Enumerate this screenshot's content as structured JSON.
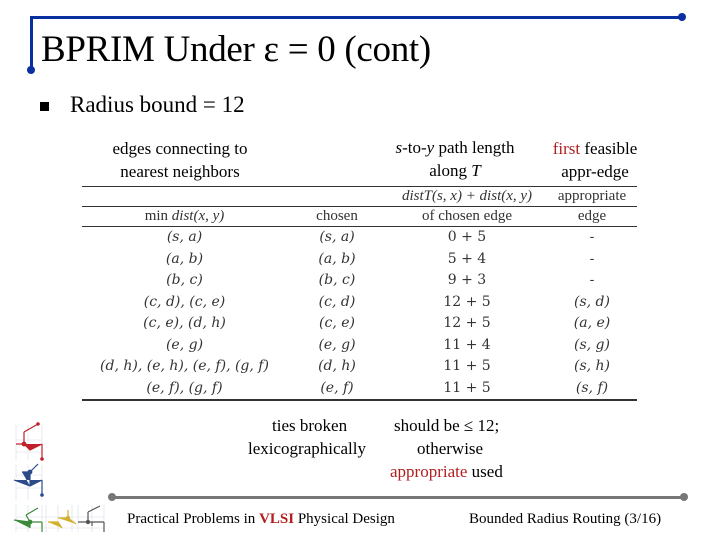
{
  "slide": {
    "title": "BPRIM Under ε = 0 (cont)",
    "bullet": "Radius bound = 12",
    "annotations": {
      "left_line1": "edges connecting to",
      "left_line2": "nearest neighbors",
      "mid_line1_var1": "s",
      "mid_line1_mid": "-to-",
      "mid_line1_var2": "y",
      "mid_line1_rest": " path length",
      "mid_line2_text": "along ",
      "mid_line2_var": "T",
      "right_line1_red": "first",
      "right_line1_rest": " feasible",
      "right_line2": "appr-edge"
    },
    "table": {
      "headers": {
        "col1_top": "",
        "col1_bottom_prefix": "min ",
        "col1_bottom_math": "dist(x, y)",
        "col2_top": "",
        "col2_bottom": "chosen",
        "col3_top": "distT(s, x) + dist(x, y)",
        "col3_bottom": "of chosen edge",
        "col4_top": "appropriate",
        "col4_bottom": "edge"
      },
      "rows": [
        {
          "min_dist": "(s, a)",
          "chosen": "(s, a)",
          "path": "0 + 5",
          "appropriate": "-"
        },
        {
          "min_dist": "(a, b)",
          "chosen": "(a, b)",
          "path": "5 + 4",
          "appropriate": "-"
        },
        {
          "min_dist": "(b, c)",
          "chosen": "(b, c)",
          "path": "9 + 3",
          "appropriate": "-"
        },
        {
          "min_dist": "(c, d), (c, e)",
          "chosen": "(c, d)",
          "path": "12 + 5",
          "appropriate": "(s, d)"
        },
        {
          "min_dist": "(c, e), (d, h)",
          "chosen": "(c, e)",
          "path": "12 + 5",
          "appropriate": "(a, e)"
        },
        {
          "min_dist": "(e, g)",
          "chosen": "(e, g)",
          "path": "11 + 4",
          "appropriate": "(s, g)"
        },
        {
          "min_dist": "(d, h), (e, h), (e, f), (g, f)",
          "chosen": "(d, h)",
          "path": "11 + 5",
          "appropriate": "(s, h)"
        },
        {
          "min_dist": "(e, f), (g, f)",
          "chosen": "(e, f)",
          "path": "11 + 5",
          "appropriate": "(s, f)"
        }
      ]
    },
    "notes": {
      "ties_line1": "ties broken",
      "ties_line2": "lexicographically",
      "should_line1": "should be ≤ 12;",
      "should_line2": "otherwise",
      "should_line3_red": "appropriate",
      "should_line3_rest": " used"
    },
    "footer": {
      "left_prefix": "Practical Problems in ",
      "left_highlight": "VLSI",
      "left_suffix": " Physical Design",
      "right": "Bounded Radius Routing (3/16)"
    },
    "colors": {
      "frame_blue": "#0a2fa0",
      "accent_red": "#b01e1e",
      "footer_gray": "#777777"
    }
  }
}
